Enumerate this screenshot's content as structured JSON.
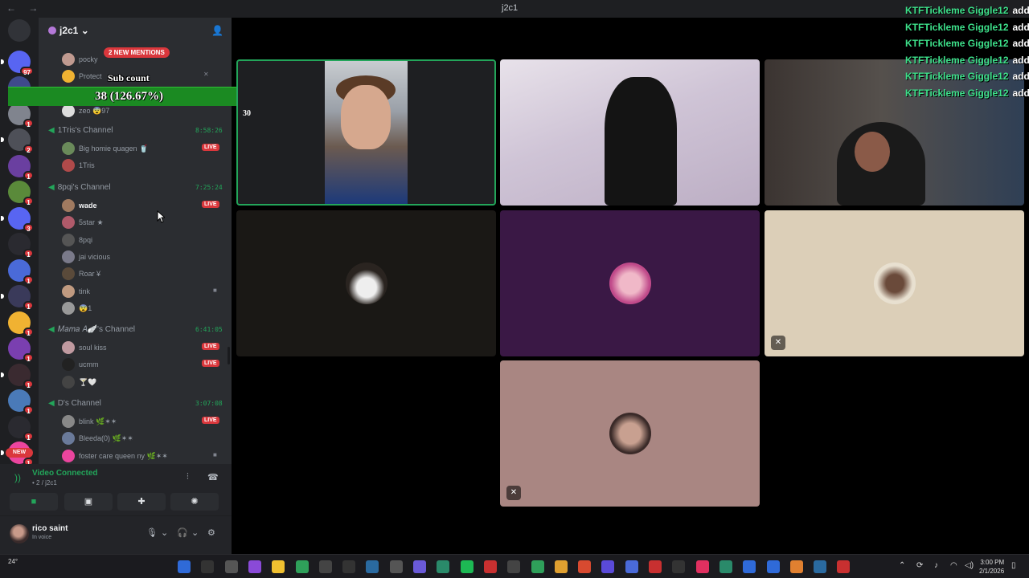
{
  "window": {
    "title": "j2c1",
    "nav_glyphs": "← →"
  },
  "rail": {
    "servers": [
      {
        "color": "#5865f2",
        "badge": "97"
      },
      {
        "color": "#3f4a8c",
        "badge": "1"
      },
      {
        "color": "#80848e",
        "badge": "1"
      },
      {
        "color": "#4e5058",
        "badge": "2"
      },
      {
        "color": "#6a3fa0",
        "badge": "1"
      },
      {
        "color": "#5a8a3a",
        "badge": "1"
      },
      {
        "color": "#5865f2",
        "badge": "3"
      },
      {
        "color": "#2a2a30",
        "badge": "1"
      },
      {
        "color": "#4a6ad8",
        "badge": "1"
      },
      {
        "color": "#3a3a5a",
        "badge": "1"
      },
      {
        "color": "#f0b232",
        "badge": "1"
      },
      {
        "color": "#7a3fb0",
        "badge": "1"
      },
      {
        "color": "#3a2a30",
        "badge": "1"
      },
      {
        "color": "#4a7ab8",
        "badge": "1"
      },
      {
        "color": "#2a2a30",
        "badge": "1"
      },
      {
        "color": "#eb459e",
        "badge": "1"
      },
      {
        "color": "#f0b232",
        "badge": "1"
      }
    ],
    "new_label": "NEW"
  },
  "sidebar": {
    "server_name": "j2c1 ⌄",
    "new_mentions": "2 NEW MENTIONS",
    "channels": [
      {
        "name": "1Tris's Channel",
        "time": "8:58:26",
        "members": [
          {
            "name": "Big homie quagen 🥤",
            "live": "LIVE",
            "color": "#6a8a5a"
          },
          {
            "name": "1Tris",
            "color": "#b04a4a"
          }
        ]
      },
      {
        "name": "8pqi's Channel",
        "time": "7:25:24",
        "members": [
          {
            "name": "wade",
            "live": "LIVE",
            "active": true,
            "color": "#a07a60"
          },
          {
            "name": "5star ★",
            "color": "#b05a6a"
          },
          {
            "name": "8pqi",
            "color": "#555"
          },
          {
            "name": "jai vicious",
            "color": "#7a7a8a"
          },
          {
            "name": "Roar ¥",
            "color": "#5a4a3a"
          },
          {
            "name": "tink",
            "color": "#c09a80",
            "cam": "■"
          },
          {
            "name": "😨1",
            "color": "#999"
          }
        ]
      },
      {
        "name": "𝑀𝑎𝑚𝑎 𝐴🪽's Channel",
        "time": "6:41:05",
        "members": [
          {
            "name": "soul kiss",
            "live": "LIVE",
            "color": "#c09aa0"
          },
          {
            "name": "ucmm",
            "live": "LIVE",
            "color": "#222"
          },
          {
            "name": "🍸🤍",
            "color": "#444"
          }
        ]
      },
      {
        "name": "D's Channel",
        "time": "3:07:08",
        "members": [
          {
            "name": "blink 🌿✶✶",
            "live": "LIVE",
            "color": "#888"
          },
          {
            "name": "Bleeda(0) 🌿✶✶",
            "color": "#6a7a9a"
          },
          {
            "name": "foster care queen ny 🌿✶✶",
            "color": "#eb459e",
            "cam": "■"
          }
        ]
      }
    ],
    "top_members": [
      {
        "name": "pocky",
        "color": "#c09a90"
      },
      {
        "name": "Protect",
        "color": "#f0b232",
        "mute": "✕"
      },
      {
        "name": "zeo 😨97",
        "color": "#ddd"
      }
    ]
  },
  "overlay": {
    "sub_title": "Sub count",
    "sub_value": "38 (126.67%)",
    "tile_count": "30"
  },
  "voice": {
    "status": "Video Connected",
    "location": "• 2 / j2c1"
  },
  "user": {
    "name": "rico saint",
    "status": "In voice"
  },
  "chat": {
    "lines": [
      {
        "user": "KTFTickleme Giggle12",
        "msg": "add J"
      },
      {
        "user": "KTFTickleme Giggle12",
        "msg": "add J"
      },
      {
        "user": "KTFTickleme Giggle12",
        "msg": "add J"
      },
      {
        "user": "KTFTickleme Giggle12",
        "msg": "add J"
      },
      {
        "user": "KTFTickleme Giggle12",
        "msg": "add J"
      },
      {
        "user": "KTFTickleme Giggle12",
        "msg": "add J"
      }
    ]
  },
  "taskbar": {
    "weather": "24°",
    "time": "3:00 PM",
    "date": "2/1/2026",
    "apps": [
      "#2f6ad8",
      "#333",
      "#555",
      "#8a4ad8",
      "#f0c030",
      "#2fa05a",
      "#444",
      "#333",
      "#2a6aa0",
      "#555",
      "#6a5ad8",
      "#2a8a6a",
      "#1db954",
      "#c83030",
      "#444",
      "#2fa05a",
      "#e0a030",
      "#d84a30",
      "#5a4ad8",
      "#4a6ad8",
      "#c83030",
      "#333",
      "#e03060",
      "#2a8a6a",
      "#2f6ad8",
      "#2f6ad8",
      "#e08030",
      "#2a6aa0",
      "#c83030"
    ]
  }
}
